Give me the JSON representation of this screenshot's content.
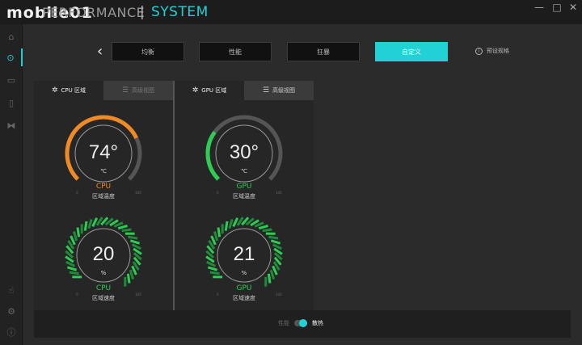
{
  "titlebar": {
    "logo": "mobile01",
    "app_name": "PERFORMANCE",
    "section": "SYSTEM",
    "minimize": "—",
    "maximize": "□",
    "close": "✕"
  },
  "modes": [
    {
      "label": "均衡",
      "active": false
    },
    {
      "label": "性能",
      "active": false
    },
    {
      "label": "狂暴",
      "active": false
    },
    {
      "label": "自定义",
      "active": true
    }
  ],
  "preset_info": "预设规格",
  "cpu_panel": {
    "tab_zone": "CPU 区域",
    "tab_advanced": "高级视图",
    "temp": {
      "value": "74°",
      "unit": "℃",
      "name": "CPU",
      "label": "区域温度",
      "fraction": 0.74,
      "color": "#f08a24",
      "min": "0",
      "max": "100"
    },
    "fan": {
      "value": "20",
      "unit": "%",
      "name": "CPU",
      "label": "区域速度",
      "min": "0",
      "max": "100"
    }
  },
  "gpu_panel": {
    "tab_zone": "GPU 区域",
    "tab_advanced": "高级视图",
    "temp": {
      "value": "30°",
      "unit": "℃",
      "name": "GPU",
      "label": "区域温度",
      "fraction": 0.3,
      "color": "#2ecc55",
      "min": "0",
      "max": "100"
    },
    "fan": {
      "value": "21",
      "unit": "%",
      "name": "GPU",
      "label": "区域速度",
      "min": "0",
      "max": "100"
    }
  },
  "footer": {
    "toggle_left": "性能",
    "toggle_right": "散热"
  },
  "colors": {
    "accent": "#22d1d6",
    "cpu": "#f08a24",
    "gpu": "#2ecc55"
  }
}
